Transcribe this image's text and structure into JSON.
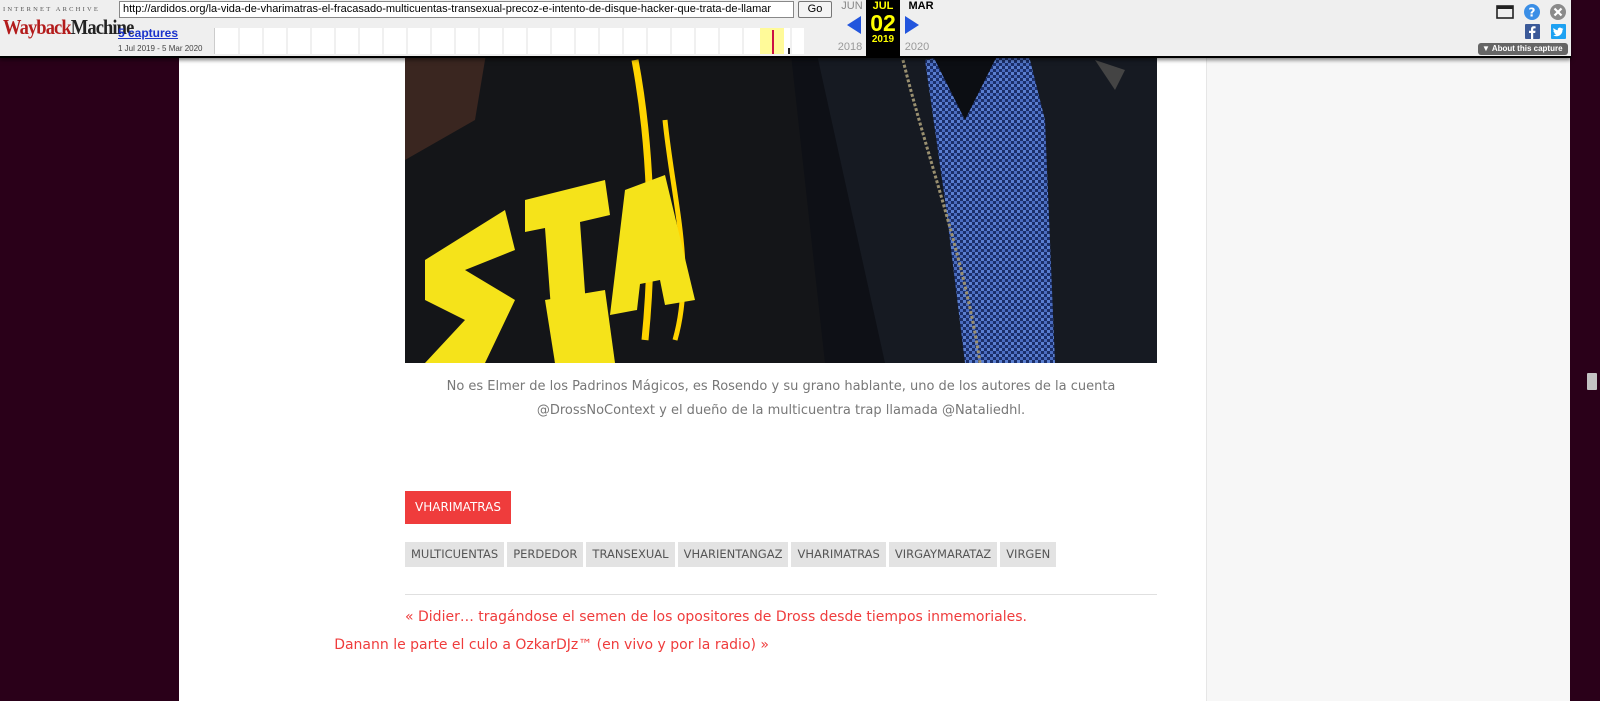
{
  "wayback": {
    "logo_top": "INTERNET ARCHIVE",
    "logo_wayback": "Wayback",
    "logo_machine": "Machine",
    "url": "http://ardidos.org/la-vida-de-vharimatras-el-fracasado-multicuentas-transexual-precoz-e-intento-de-disque-hacker-que-trata-de-llamar",
    "go_label": "Go",
    "captures_label": "5 captures",
    "date_range": "1 Jul 2019 - 5 Mar 2020",
    "prev_month": "JUN",
    "cur_month": "JUL",
    "next_month": "MAR",
    "cur_day": "02",
    "prev_year": "2018",
    "cur_year": "2019",
    "next_year": "2020",
    "about_label": "About this capture"
  },
  "post": {
    "caption": "No es Elmer de los Padrinos Mágicos, es Rosendo y su grano hablante, uno de los autores de la cuenta @DrossNoContext y el dueño de la multicuentra trap llamada @Nataliedhl.",
    "category": "VHARIMATRAS",
    "tags": [
      "MULTICUENTAS",
      "PERDEDOR",
      "TRANSEXUAL",
      "VHARIENTANGAZ",
      "VHARIMATRAS",
      "VIRGAYMARATAZ",
      "VIRGEN"
    ],
    "prev_post": "« Didier… tragándose el semen de los opositores de Dross desde tiempos inmemoriales.",
    "next_post": "Danann le parte el culo a OzkarDJz™ (en vivo y por la radio) »"
  },
  "icons": {
    "window": "window-icon",
    "help": "help-icon",
    "close": "close-icon",
    "facebook": "facebook-icon",
    "twitter": "twitter-icon"
  },
  "colors": {
    "accent": "#ef3c3c",
    "background": "#2a0019",
    "wayback_highlight": "#ffff00"
  }
}
